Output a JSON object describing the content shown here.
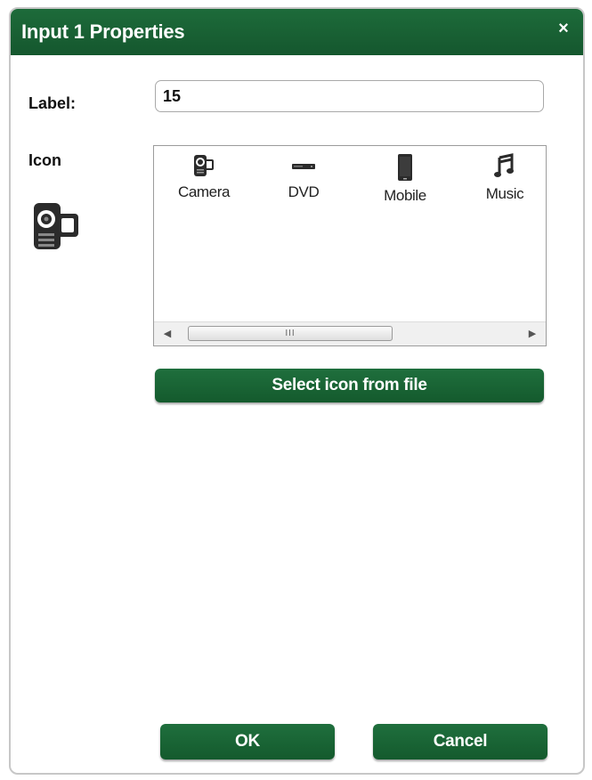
{
  "dialog": {
    "title": "Input 1 Properties",
    "close_label": "×"
  },
  "form": {
    "label_caption": "Label:",
    "label_value": "15",
    "icon_caption": "Icon"
  },
  "icon_list": {
    "items": [
      {
        "label": "Camera",
        "icon": "camera-icon"
      },
      {
        "label": "DVD",
        "icon": "dvd-icon"
      },
      {
        "label": "Mobile",
        "icon": "mobile-icon"
      },
      {
        "label": "Music",
        "icon": "music-icon"
      }
    ],
    "scroll_left": "◀",
    "scroll_right": "▶",
    "scroll_grip": "III"
  },
  "buttons": {
    "select_icon": "Select icon from file",
    "ok": "OK",
    "cancel": "Cancel"
  },
  "colors": {
    "brand_green": "#1d6b3a"
  }
}
